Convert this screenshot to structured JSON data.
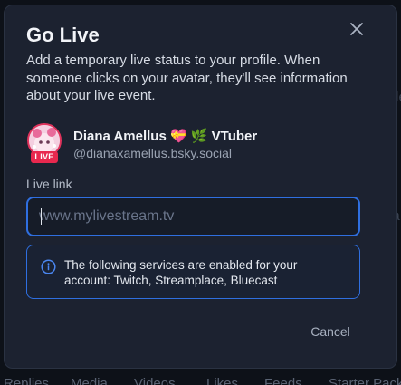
{
  "dialog": {
    "title": "Go Live",
    "description": "Add a temporary live status to your profile. When someone clicks on your avatar, they'll see information about your live event.",
    "close_icon": "close-icon"
  },
  "profile": {
    "display_name": "Diana Amellus 💝 🌿 VTuber",
    "handle": "@dianaxamellus.bsky.social",
    "live_badge": "LIVE"
  },
  "live_link": {
    "label": "Live link",
    "placeholder": "www.mylivestream.tv",
    "value": ""
  },
  "info_box": {
    "icon": "info-icon",
    "text": "The following services are enabled for your account: Twitch, Streamplace, Bluecast"
  },
  "actions": {
    "cancel_label": "Cancel"
  },
  "background": {
    "fragment_right_1": "ofile",
    "fragment_right_2": "ea",
    "tabs": [
      "Replies",
      "Media",
      "Videos",
      "Likes",
      "Feeds",
      "Starter Packs"
    ]
  },
  "colors": {
    "accent": "#2f6fe0",
    "live_badge": "#e8284e",
    "dialog_bg": "#1c2230"
  }
}
